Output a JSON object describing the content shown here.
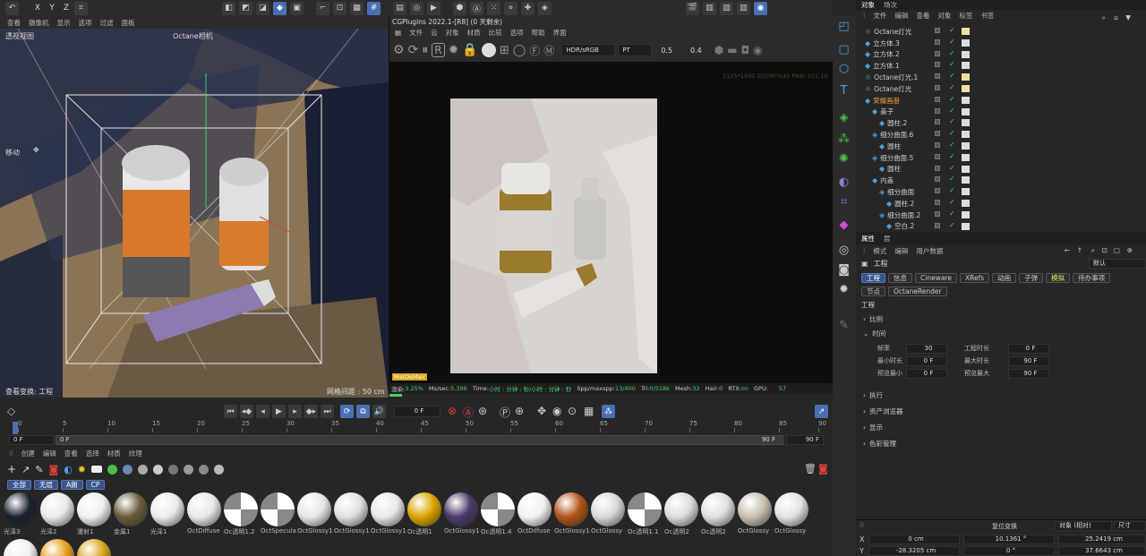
{
  "top_toolbar": {
    "axes": [
      "X",
      "Y",
      "Z"
    ]
  },
  "viewport_menu": [
    "查看",
    "摄像机",
    "显示",
    "选项",
    "过滤",
    "面板"
  ],
  "viewport": {
    "name": "透视视图",
    "camera": "Octane相机",
    "mode": "移动",
    "footer_left": "查看变换: 工程",
    "footer_right": "网格间距 : 50 cm"
  },
  "render": {
    "title": "CGPlugins   2022.1-[R8] (0 天剩余)",
    "menu": [
      "文件",
      "云",
      "对象",
      "材质",
      "比较",
      "选项",
      "帮助",
      "界面"
    ],
    "color_mode": "HDR/sRGB",
    "kernel": "PT",
    "val1": "0.5",
    "val2": "0.4",
    "info": "1125*1500 ZOOM:%40  PAN:-101,10",
    "mat_tag": "MatDeMair",
    "status": [
      {
        "k": "渲染:",
        "v": "3.25%"
      },
      {
        "k": "Ms/sec:",
        "v": "5.396"
      },
      {
        "k": "Time:",
        "v": "小时 : 分钟 : 秒/小时 : 分钟 : 秒"
      },
      {
        "k": "Spp/maxspp:",
        "v": "13/400"
      },
      {
        "k": "Tri:",
        "v": "0/518k"
      },
      {
        "k": "Mesh:",
        "v": "32"
      },
      {
        "k": "Hair:",
        "v": "0"
      },
      {
        "k": "RTX:",
        "v": "on"
      },
      {
        "k": "GPU:",
        "v": "57"
      }
    ]
  },
  "timeline": {
    "frame_field": "0 F",
    "ticks": [
      "0",
      "5",
      "10",
      "15",
      "20",
      "25",
      "30",
      "35",
      "40",
      "45",
      "50",
      "55",
      "60",
      "65",
      "70",
      "75",
      "80",
      "85",
      "90"
    ],
    "start": "0 F",
    "start2": "0 F",
    "end": "90 F",
    "end2": "90 F"
  },
  "material_menu": [
    "创建",
    "编辑",
    "查看",
    "选择",
    "材质",
    "纹理"
  ],
  "material_filters": [
    "全部",
    "无层",
    "A朗",
    "CP"
  ],
  "materials": [
    {
      "name": "光泽3",
      "c": "#1a2030"
    },
    {
      "name": "光泽2",
      "c": "#eaeaea"
    },
    {
      "name": "漫射1",
      "c": "#f0f0f0"
    },
    {
      "name": "金属1",
      "c": "#6b5a3c"
    },
    {
      "name": "光泽1",
      "c": "#ececec"
    },
    {
      "name": "OctDiffuse",
      "c": "#e8e8e8"
    },
    {
      "name": "Oc透明1.2",
      "c": "chk"
    },
    {
      "name": "OctSpecula",
      "c": "chk"
    },
    {
      "name": "OctGlossy1",
      "c": "#e6e6e6"
    },
    {
      "name": "OctGlossy1",
      "c": "#e0e0e0"
    },
    {
      "name": "OctGlossy1",
      "c": "#e8e8e8"
    },
    {
      "name": "Oc透明1",
      "c": "#d9a400"
    },
    {
      "name": "OctGlossy1",
      "c": "#4a3a6a"
    },
    {
      "name": "Oc透明1.4",
      "c": "chk"
    },
    {
      "name": "OctDiffuse",
      "c": "#f2f2f2"
    },
    {
      "name": "OctGlossy1",
      "c": "#b0541a"
    },
    {
      "name": "OctGlossy",
      "c": "#d8d8d8"
    },
    {
      "name": "Oc透明1.1",
      "c": "chk"
    },
    {
      "name": "Oc透明2",
      "c": "#dcdcdc"
    },
    {
      "name": "Oc透明2",
      "c": "#e0e0e0"
    },
    {
      "name": "OctGlossy",
      "c": "#c8c0b0"
    },
    {
      "name": "OctGlossy",
      "c": "#e2e2e2"
    }
  ],
  "objects_panel": {
    "tabs": [
      "对象",
      "场次"
    ],
    "menu": [
      "文件",
      "编辑",
      "查看",
      "对象",
      "标签",
      "书签"
    ],
    "rows": [
      {
        "name": "Octane灯光",
        "indent": 0,
        "color": "#cfcfcf"
      },
      {
        "name": "立方体.3",
        "indent": 0,
        "color": "#cfcfcf"
      },
      {
        "name": "立方体.2",
        "indent": 0,
        "color": "#cfcfcf"
      },
      {
        "name": "立方体.1",
        "indent": 0,
        "color": "#cfcfcf"
      },
      {
        "name": "Octane灯光.1",
        "indent": 0,
        "color": "#cfcfcf"
      },
      {
        "name": "Octane灯光",
        "indent": 0,
        "color": "#cfcfcf"
      },
      {
        "name": "荣耀画册",
        "indent": 0,
        "color": "#e8a040"
      },
      {
        "name": "盖子",
        "indent": 1,
        "color": "#cfcfcf"
      },
      {
        "name": "圆柱.2",
        "indent": 2,
        "color": "#cfcfcf"
      },
      {
        "name": "细分曲面.6",
        "indent": 1,
        "color": "#cfcfcf"
      },
      {
        "name": "圆柱",
        "indent": 2,
        "color": "#cfcfcf"
      },
      {
        "name": "细分曲面.5",
        "indent": 1,
        "color": "#cfcfcf"
      },
      {
        "name": "圆柱",
        "indent": 2,
        "color": "#cfcfcf"
      },
      {
        "name": "内盖",
        "indent": 1,
        "color": "#cfcfcf"
      },
      {
        "name": "细分曲面",
        "indent": 2,
        "color": "#cfcfcf"
      },
      {
        "name": "圆柱.2",
        "indent": 3,
        "color": "#cfcfcf"
      },
      {
        "name": "细分曲面.2",
        "indent": 2,
        "color": "#cfcfcf"
      },
      {
        "name": "空白.2",
        "indent": 3,
        "color": "#cfcfcf"
      }
    ]
  },
  "attr_panel": {
    "tabs": [
      "属性",
      "层"
    ],
    "menu": [
      "模式",
      "编辑",
      "用户数据"
    ],
    "title": "工程",
    "preset": "默认",
    "tabs_row1": [
      "工程",
      "信息",
      "Cineware",
      "XRefs",
      "动画",
      "子弹",
      "模拟",
      "待办事项"
    ],
    "tabs_row2": [
      "节点",
      "OctaneRender"
    ],
    "section": "工程",
    "sub1": "比例",
    "sub2": "时间",
    "fields": [
      {
        "l": "帧率",
        "v": "30",
        "l2": "工程时长",
        "v2": "0 F"
      },
      {
        "l": "最小时长",
        "v": "0 F",
        "l2": "最大时长",
        "v2": "90 F"
      },
      {
        "l": "预览最小",
        "v": "0 F",
        "l2": "预览最大",
        "v2": "90 F"
      }
    ],
    "sections": [
      "执行",
      "资产浏览器",
      "显示",
      "色彩管理"
    ]
  },
  "coord_panel": {
    "reset": "复位变换",
    "mode": "对象 (相对)",
    "size": "尺寸",
    "x_label": "X",
    "y_label": "Y",
    "x": "0 cm",
    "x2": "10.1361 °",
    "x3": "25.2419 cm",
    "y": "-28.3205 cm",
    "y2": "0 °",
    "y3": "37.6643 cm"
  }
}
